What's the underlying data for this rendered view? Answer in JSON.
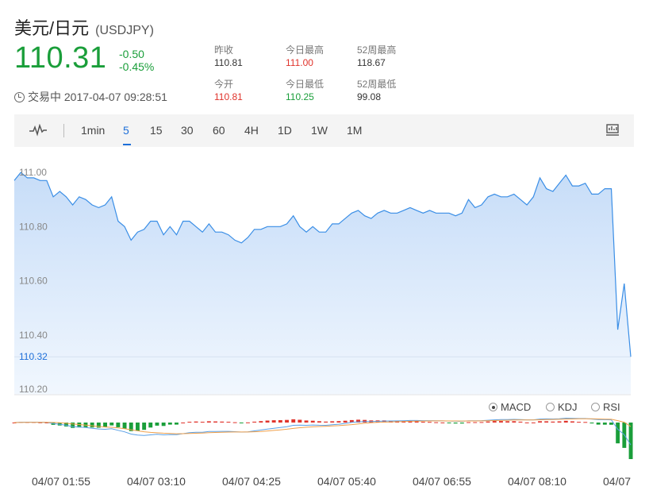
{
  "header": {
    "name": "美元/日元",
    "code": "(USDJPY)",
    "price": "110.31",
    "change": "-0.50",
    "change_pct": "-0.45%",
    "status": "交易中 2017-04-07 09:28:51"
  },
  "stats": [
    {
      "label": "昨收",
      "value": "110.81",
      "color": "default"
    },
    {
      "label": "今开",
      "value": "110.81",
      "color": "red"
    },
    {
      "label": "今日最高",
      "value": "111.00",
      "color": "red"
    },
    {
      "label": "今日最低",
      "value": "110.25",
      "color": "green"
    },
    {
      "label": "52周最高",
      "value": "118.67",
      "color": "default"
    },
    {
      "label": "52周最低",
      "value": "99.08",
      "color": "default"
    }
  ],
  "toolbar": {
    "items": [
      "1min",
      "5",
      "15",
      "30",
      "60",
      "4H",
      "1D",
      "1W",
      "1M"
    ],
    "active": "5"
  },
  "indicators": {
    "items": [
      "MACD",
      "KDJ",
      "RSI"
    ],
    "selected": "MACD"
  },
  "colors": {
    "up": "#e0332b",
    "down": "#1a9e3a",
    "line": "#3a8ee6",
    "fill_top": "#c7ddf8",
    "fill_bottom": "#f1f7fe",
    "active": "#1e6fd9"
  },
  "chart_data": {
    "type": "area",
    "x_ticks": [
      "04/07 01:55",
      "04/07 03:10",
      "04/07 04:25",
      "04/07 05:40",
      "04/07 06:55",
      "04/07 08:10",
      "04/07"
    ],
    "y_ticks": [
      "111.00",
      "110.80",
      "110.60",
      "110.40",
      "110.20"
    ],
    "ylim": [
      110.18,
      111.05
    ],
    "last_label": "110.32",
    "series": [
      {
        "values": [
          110.97,
          111.0,
          110.98,
          110.98,
          110.97,
          110.97,
          110.91,
          110.93,
          110.91,
          110.88,
          110.91,
          110.9,
          110.88,
          110.87,
          110.88,
          110.91,
          110.82,
          110.8,
          110.75,
          110.78,
          110.79,
          110.82,
          110.82,
          110.77,
          110.8,
          110.77,
          110.82,
          110.82,
          110.8,
          110.78,
          110.81,
          110.78,
          110.78,
          110.77,
          110.75,
          110.74,
          110.76,
          110.79,
          110.79,
          110.8,
          110.8,
          110.8,
          110.81,
          110.84,
          110.8,
          110.78,
          110.8,
          110.78,
          110.78,
          110.81,
          110.81,
          110.83,
          110.85,
          110.86,
          110.84,
          110.83,
          110.85,
          110.86,
          110.85,
          110.85,
          110.86,
          110.87,
          110.86,
          110.85,
          110.86,
          110.85,
          110.85,
          110.85,
          110.84,
          110.85,
          110.9,
          110.87,
          110.88,
          110.91,
          110.92,
          110.91,
          110.91,
          110.92,
          110.9,
          110.88,
          110.91,
          110.98,
          110.94,
          110.93,
          110.96,
          110.99,
          110.95,
          110.95,
          110.96,
          110.92,
          110.92,
          110.94,
          110.94,
          110.42,
          110.59,
          110.32
        ]
      }
    ]
  }
}
